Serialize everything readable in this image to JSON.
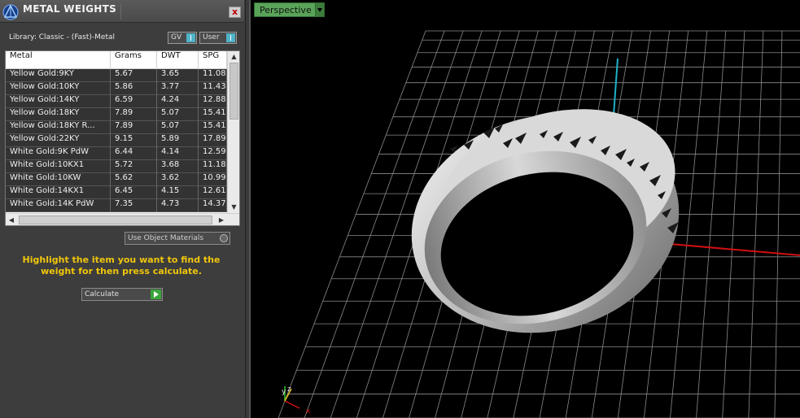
{
  "panel": {
    "title": "METAL WEIGHTS",
    "close_label": "x",
    "library_label": "Library: Classic - (Fast)-Metal",
    "toggles": {
      "gv": "GV",
      "user": "User"
    },
    "accent_color": "#4fb3c8"
  },
  "table": {
    "headers": [
      "Metal",
      "Grams",
      "DWT",
      "SPG"
    ],
    "rows": [
      [
        "Yellow Gold:9KY",
        "5.67",
        "3.65",
        "11.08"
      ],
      [
        "Yellow Gold:10KY",
        "5.86",
        "3.77",
        "11.43"
      ],
      [
        "Yellow Gold:14KY",
        "6.59",
        "4.24",
        "12.88"
      ],
      [
        "Yellow Gold:18KY",
        "7.89",
        "5.07",
        "15.41"
      ],
      [
        "Yellow Gold:18KY R...",
        "7.89",
        "5.07",
        "15.41"
      ],
      [
        "Yellow Gold:22KY",
        "9.15",
        "5.89",
        "17.89"
      ],
      [
        "White Gold:9K PdW",
        "6.44",
        "4.14",
        "12.59"
      ],
      [
        "White Gold:10KX1",
        "5.72",
        "3.68",
        "11.18"
      ],
      [
        "White Gold:10KW",
        "5.62",
        "3.62",
        "10.99"
      ],
      [
        "White Gold:14KX1",
        "6.45",
        "4.15",
        "12.61"
      ],
      [
        "White Gold:14K PdW",
        "7.35",
        "4.73",
        "14.37"
      ]
    ]
  },
  "use_object_materials": {
    "label": "Use Object Materials"
  },
  "hint": "Highlight the item you want to find the weight for then press calculate.",
  "calculate": {
    "label": "Calculate",
    "color": "#3aa53a"
  },
  "viewport": {
    "view_name": "Perspective",
    "axis_labels": {
      "x": "x",
      "y": "y",
      "z": "z"
    },
    "colors": {
      "grid": "#8a8a8a",
      "x_axis": "#d01010",
      "y_axis": "#1fb0c8",
      "z_axis": "#2ecc2e"
    }
  }
}
